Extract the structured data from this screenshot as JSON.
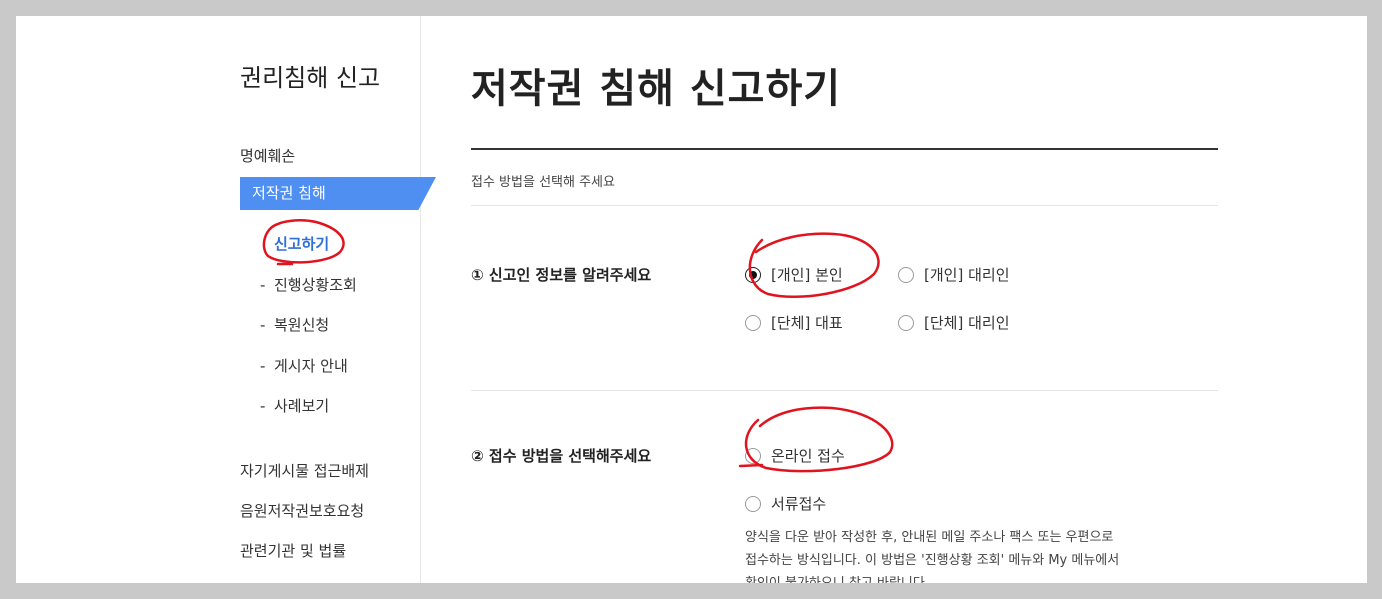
{
  "sidebar": {
    "title": "권리침해 신고",
    "items": [
      {
        "label": "명예훼손"
      },
      {
        "label": "저작권 침해"
      },
      {
        "label": "자기게시물 접근배제"
      },
      {
        "label": "음원저작권보호요청"
      },
      {
        "label": "관련기관 및 법률"
      }
    ],
    "sub_current": "신고하기",
    "sub_items": [
      {
        "dash": "-",
        "label": "진행상황조회"
      },
      {
        "dash": "-",
        "label": "복원신청"
      },
      {
        "dash": "-",
        "label": "게시자 안내"
      },
      {
        "dash": "-",
        "label": "사례보기"
      }
    ]
  },
  "main": {
    "title": "저작권 침해 신고하기",
    "guide": "접수 방법을 선택해 주세요",
    "q1": {
      "label": "① 신고인 정보를 알려주세요",
      "options": [
        {
          "tag": "[개인]",
          "label": "본인",
          "checked": true
        },
        {
          "tag": "[개인]",
          "label": "대리인",
          "checked": false
        },
        {
          "tag": "[단체]",
          "label": "대표",
          "checked": false
        },
        {
          "tag": "[단체]",
          "label": "대리인",
          "checked": false
        }
      ]
    },
    "q2": {
      "label": "② 접수 방법을 선택해주세요",
      "options": [
        {
          "label": "온라인 접수",
          "checked": false
        },
        {
          "label": "서류접수",
          "checked": false
        }
      ],
      "note_lines": [
        "양식을 다운 받아 작성한 후, 안내된 메일 주소나 팩스 또는 우편으로",
        "접수하는 방식입니다. 이 방법은 '진행상황 조회' 메뉴와 My 메뉴에서",
        "확인이 불가하오니 참고 바랍니다."
      ]
    }
  },
  "colors": {
    "accent": "#4f8ff2",
    "annotation": "#e0141e"
  }
}
